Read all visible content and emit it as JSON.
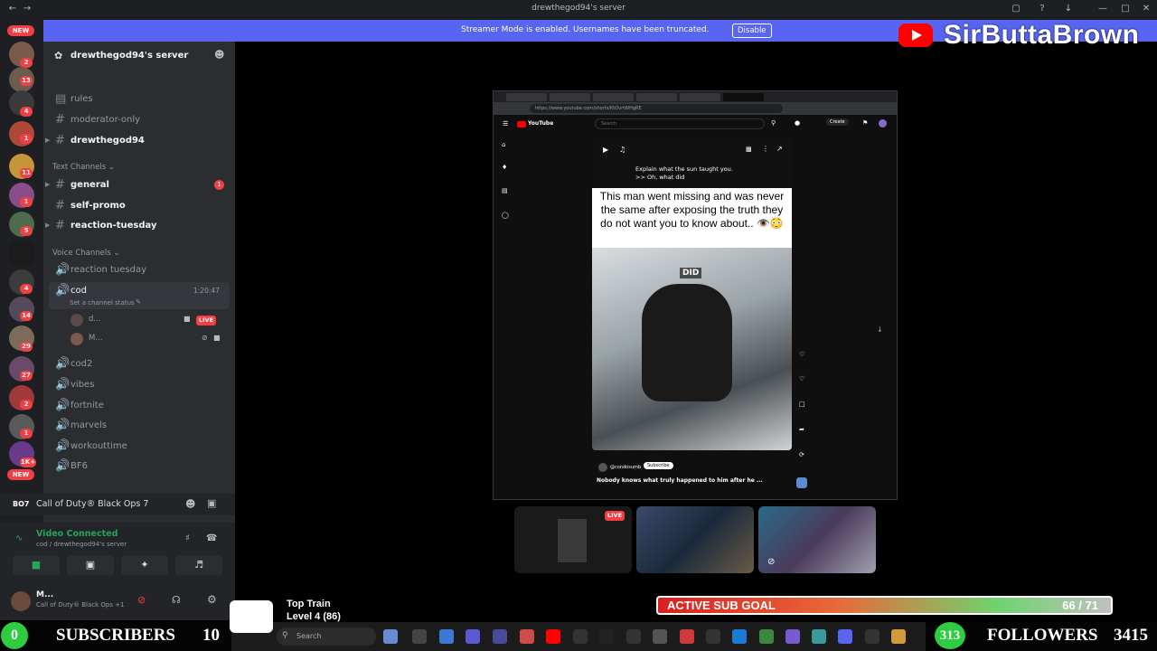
{
  "window": {
    "title": "drewthegod94's server"
  },
  "banner": {
    "message": "Streamer Mode is enabled. Usernames have been truncated.",
    "button": "Disable"
  },
  "brand": {
    "channel_name": "SirButtaBrown"
  },
  "rail": {
    "badges": [
      "3",
      "2",
      "13",
      "4",
      "1",
      "11",
      "1",
      "5",
      "4",
      "14",
      "29",
      "27",
      "2",
      "1",
      "1K+"
    ],
    "new_label": "NEW"
  },
  "sidebar": {
    "server_name": "drewthegod94's server",
    "top_channels": [
      {
        "label": "rules"
      },
      {
        "label": "moderator-only"
      },
      {
        "label": "drewthegod94"
      }
    ],
    "text_category": "Text Channels",
    "text_channels": [
      {
        "label": "general",
        "badge": "1"
      },
      {
        "label": "self-promo"
      },
      {
        "label": "reaction-tuesday"
      }
    ],
    "voice_category": "Voice Channels",
    "voice_channels_top": [
      {
        "label": "reaction tuesday"
      },
      {
        "label": "cod",
        "timer": "1:20:47",
        "status": "Set a channel status"
      }
    ],
    "voice_users": [
      {
        "name": "d...",
        "live": "LIVE"
      },
      {
        "name": "M..."
      }
    ],
    "voice_channels_bottom": [
      {
        "label": "cod2"
      },
      {
        "label": "vibes"
      },
      {
        "label": "fortnite"
      },
      {
        "label": "marvels"
      },
      {
        "label": "workouttime"
      },
      {
        "label": "BF6"
      }
    ]
  },
  "game_panel": {
    "title": "Call of Duty® Black Ops 7"
  },
  "voice_panel": {
    "status": "Video Connected",
    "location": "cod / drewthegod94's server"
  },
  "user_panel": {
    "name": "M...",
    "activity": "Call of Duty® Black Ops +1"
  },
  "share": {
    "url": "https://www.youtube.com/shorts/KtOvrtWHgRE",
    "yt_label": "YouTube",
    "search_placeholder": "Search",
    "create": "Create",
    "top_text": "Explain what the sun taught you.\n>> Oh, what did",
    "caption": "This man went missing and was never the same after exposing the truth they do not want you to know about.. 👁️😳",
    "frame_text": "DID",
    "channel_handle": "@condosumb",
    "subscribe": "Subscribe",
    "description": "Nobody knows what truly happened to him after he ..."
  },
  "participants": {
    "live_label": "LIVE"
  },
  "sub_goal": {
    "label": "ACTIVE SUB GOAL",
    "count": "66 / 71",
    "progress": 0.93
  },
  "subs_bar": {
    "count": "0",
    "label": "SUBSCRIBERS",
    "value": "10"
  },
  "follow_bar": {
    "count": "313",
    "label": "FOLLOWERS",
    "value": "3415"
  },
  "top_train": {
    "title": "Top Train",
    "level": "Level 4 (86)"
  },
  "taskbar": {
    "search": "Search"
  }
}
